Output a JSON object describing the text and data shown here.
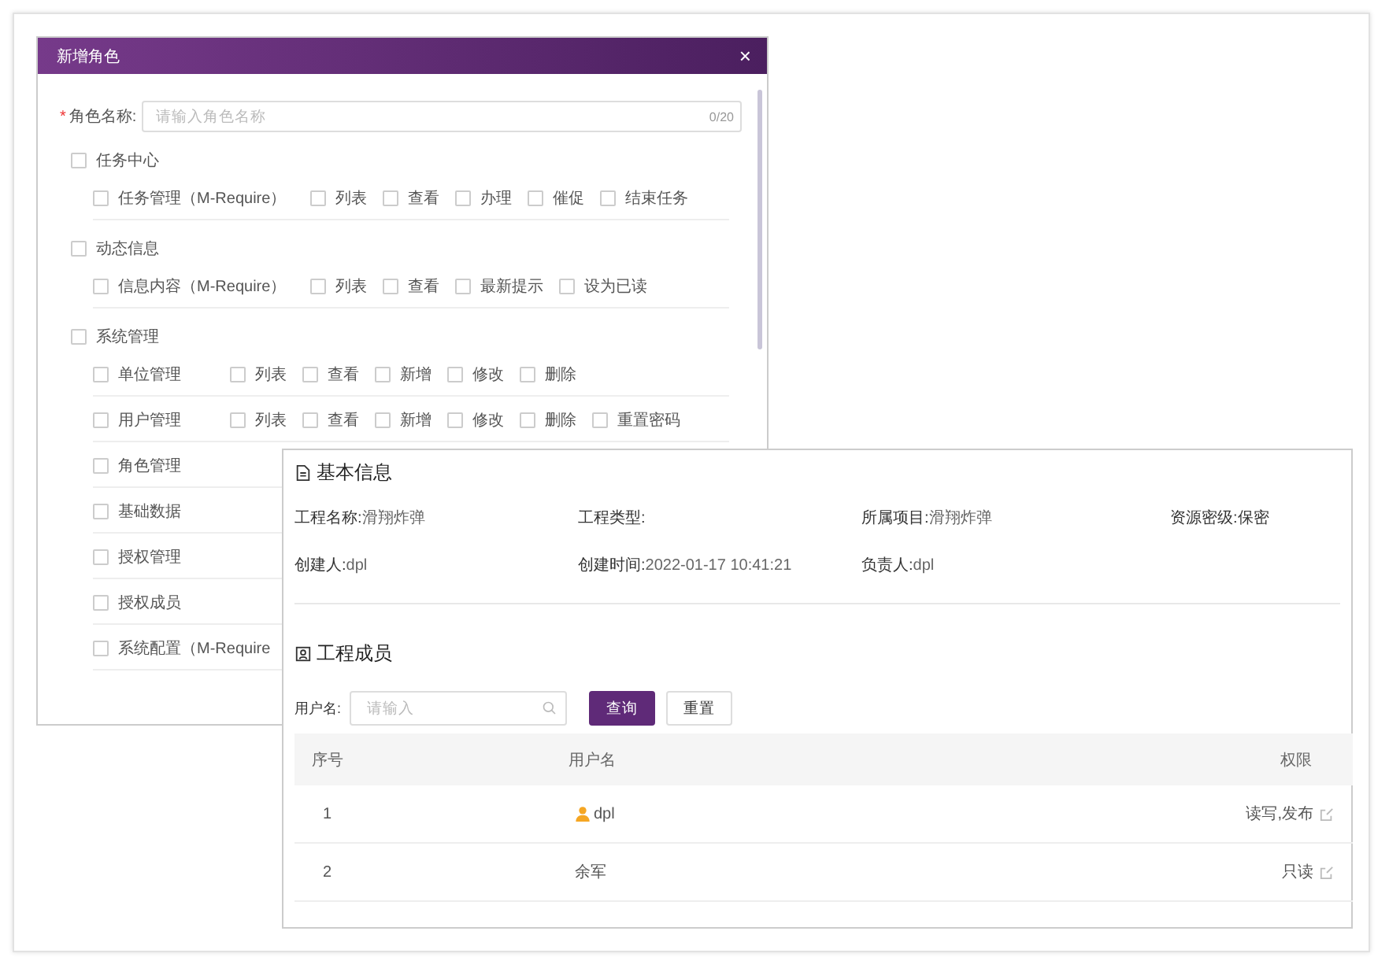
{
  "dialog": {
    "title": "新增角色",
    "close": "×",
    "name_field": {
      "required_mark": "*",
      "label": "角色名称:",
      "placeholder": "请输入角色名称",
      "counter": "0/20"
    },
    "groups": [
      {
        "label": "任务中心",
        "checked": false,
        "rows": [
          {
            "items": [
              {
                "label": "任务管理（M-Require）",
                "checked": false
              },
              {
                "label": "列表",
                "checked": false
              },
              {
                "label": "查看",
                "checked": false
              },
              {
                "label": "办理",
                "checked": false
              },
              {
                "label": "催促",
                "checked": false
              },
              {
                "label": "结束任务",
                "checked": false
              }
            ]
          }
        ]
      },
      {
        "label": "动态信息",
        "checked": false,
        "rows": [
          {
            "items": [
              {
                "label": "信息内容（M-Require）",
                "checked": false
              },
              {
                "label": "列表",
                "checked": false
              },
              {
                "label": "查看",
                "checked": false
              },
              {
                "label": "最新提示",
                "checked": false
              },
              {
                "label": "设为已读",
                "checked": false
              }
            ]
          }
        ]
      },
      {
        "label": "系统管理",
        "checked": false,
        "rows": [
          {
            "items": [
              {
                "label": "单位管理",
                "checked": false
              },
              {
                "label": "列表",
                "checked": false
              },
              {
                "label": "查看",
                "checked": false
              },
              {
                "label": "新增",
                "checked": false
              },
              {
                "label": "修改",
                "checked": false
              },
              {
                "label": "删除",
                "checked": false
              }
            ]
          },
          {
            "items": [
              {
                "label": "用户管理",
                "checked": false
              },
              {
                "label": "列表",
                "checked": false
              },
              {
                "label": "查看",
                "checked": false
              },
              {
                "label": "新增",
                "checked": false
              },
              {
                "label": "修改",
                "checked": false
              },
              {
                "label": "删除",
                "checked": false
              },
              {
                "label": "重置密码",
                "checked": false
              }
            ]
          },
          {
            "items": [
              {
                "label": "角色管理",
                "checked": false
              }
            ]
          },
          {
            "items": [
              {
                "label": "基础数据",
                "checked": false
              }
            ]
          },
          {
            "items": [
              {
                "label": "授权管理",
                "checked": false
              }
            ]
          },
          {
            "items": [
              {
                "label": "授权成员",
                "checked": false
              }
            ]
          },
          {
            "items": [
              {
                "label": "系统配置（M-Require",
                "checked": false
              }
            ]
          }
        ]
      }
    ]
  },
  "info_panel": {
    "basic_title": "基本信息",
    "fields": [
      {
        "label": "工程名称:",
        "value": "滑翔炸弹"
      },
      {
        "label": "工程类型:"
      },
      {
        "label": "所属项目:",
        "value": "滑翔炸弹"
      },
      {
        "label": "资源密级:",
        "value": "保密"
      },
      {
        "label": "创建人:",
        "value": "dpl"
      },
      {
        "label": "创建时间:",
        "value": "2022-01-17 10:41:21"
      },
      {
        "label": "负责人:",
        "value": "dpl"
      }
    ],
    "members_title": "工程成员",
    "search": {
      "label": "用户名:",
      "placeholder": "请输入"
    },
    "buttons": [
      {
        "label": "查询",
        "kind": "primary"
      },
      {
        "label": "重置",
        "kind": "default"
      }
    ],
    "table": {
      "columns": [
        "序号",
        "用户名",
        "权限"
      ],
      "rows": [
        {
          "index": "1",
          "user": "dpl",
          "owner": true,
          "permission": "读写,发布"
        },
        {
          "index": "2",
          "user": "余军",
          "owner": false,
          "permission": "只读"
        }
      ]
    }
  }
}
